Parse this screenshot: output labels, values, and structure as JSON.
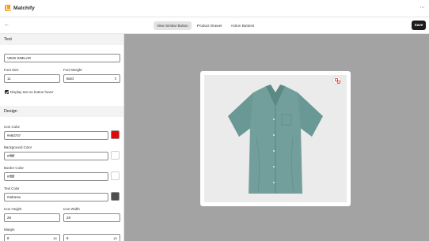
{
  "app": {
    "name": "Matchify",
    "logo_color": "#f4a21b"
  },
  "header": {
    "menu_glyph": "···"
  },
  "toolbar": {
    "back_glyph": "←",
    "tabs": [
      {
        "label": "View Similar Button",
        "active": true
      },
      {
        "label": "Product Drawer",
        "active": false
      },
      {
        "label": "Action Buttons",
        "active": false
      }
    ],
    "save_label": "Save"
  },
  "sidebar": {
    "text_section": {
      "title": "Text",
      "button_text": "VIEW SIMILAR",
      "font_size_label": "Font Size",
      "font_size_value": "11",
      "font_weight_label": "Font Weight",
      "font_weight_value": "Bold",
      "display_text_label": "Display text on button hover",
      "display_text_checked": true
    },
    "design_section": {
      "title": "Design",
      "icon_color_label": "Icon Color",
      "icon_color_value": "#e80707",
      "background_color_label": "Background Color",
      "background_color_value": "#ffffff",
      "border_color_label": "Border Color",
      "border_color_value": "#ffffff",
      "text_color_label": "Text Color",
      "text_color_value": "#4d4e4e",
      "icon_height_label": "Icon Height",
      "icon_height_value": "28",
      "icon_width_label": "Icon Width",
      "icon_width_value": "28",
      "margin_label": "Margin",
      "margin_top_value": "8",
      "margin_right_value": "8",
      "unit_suffix": "px"
    }
  },
  "preview": {
    "background": "#a3a3a3",
    "product_image": "teal-short-sleeve-shirt",
    "shirt_color": "#6e9c98",
    "similar_icon": "view-similar-icon"
  }
}
